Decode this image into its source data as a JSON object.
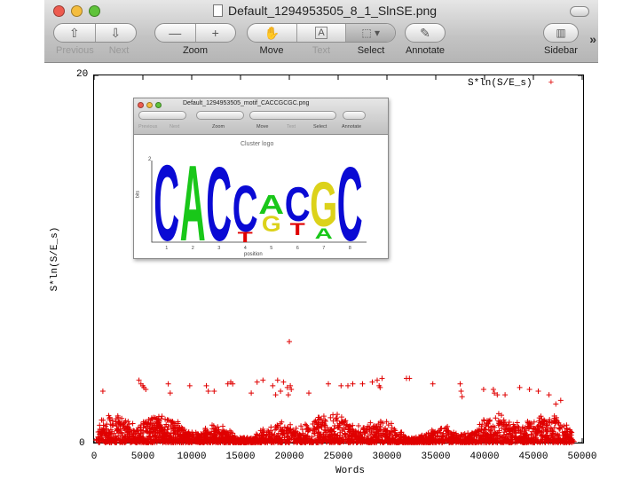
{
  "window": {
    "title": "Default_1294953505_8_1_SlnSE.png",
    "toolbar": {
      "nav": [
        "Previous",
        "Next"
      ],
      "zoom": "Zoom",
      "move": "Move",
      "text": "Text",
      "select": "Select",
      "annotate": "Annotate",
      "sidebar": "Sidebar"
    }
  },
  "inset_window": {
    "title": "Default_1294953505_motif_CACCGCGC.png",
    "toolbar": [
      "Previous",
      "Next",
      "Zoom",
      "Move",
      "Text",
      "Select",
      "Annotate"
    ],
    "logo_title": "Cluster logo",
    "logo_letters": [
      "C",
      "A",
      "C",
      "C",
      "A",
      "C",
      "G",
      "C"
    ],
    "logo_minor_letters": [
      "T",
      "G",
      "T",
      "A"
    ],
    "logo_ytick": "2",
    "logo_ylabel": "bits",
    "logo_positions": [
      "1",
      "2",
      "3",
      "4",
      "5",
      "6",
      "7",
      "8"
    ],
    "logo_xlabel": "position"
  },
  "chart_data": {
    "type": "scatter",
    "title": "",
    "xlabel": "Words",
    "ylabel": "S*ln(S/E_s)",
    "xlim": [
      0,
      50000
    ],
    "ylim": [
      0,
      20
    ],
    "xticks": [
      "0",
      "5000",
      "10000",
      "15000",
      "20000",
      "25000",
      "30000",
      "35000",
      "40000",
      "45000",
      "50000"
    ],
    "yticks": [
      "0",
      "20"
    ],
    "legend": {
      "label": "S*ln(S/E_s)",
      "position": "top-right",
      "marker": "+"
    },
    "series": [
      {
        "name": "S*ln(S/E_s)",
        "marker": "+",
        "color": "#e00000",
        "points": [
          [
            900,
            2.8
          ],
          [
            4600,
            3.4
          ],
          [
            4800,
            3.2
          ],
          [
            5100,
            3.0
          ],
          [
            5300,
            2.9
          ],
          [
            5000,
            3.1
          ],
          [
            7600,
            3.2
          ],
          [
            7800,
            2.7
          ],
          [
            9800,
            3.1
          ],
          [
            11500,
            3.1
          ],
          [
            11700,
            2.8
          ],
          [
            12300,
            2.8
          ],
          [
            13700,
            3.2
          ],
          [
            14000,
            3.3
          ],
          [
            14200,
            3.2
          ],
          [
            16100,
            2.7
          ],
          [
            16700,
            3.3
          ],
          [
            17300,
            3.4
          ],
          [
            18300,
            3.1
          ],
          [
            18600,
            2.6
          ],
          [
            18800,
            3.4
          ],
          [
            19100,
            2.8
          ],
          [
            19400,
            3.3
          ],
          [
            19800,
            3.0
          ],
          [
            20100,
            3.1
          ],
          [
            19900,
            2.6
          ],
          [
            20200,
            2.9
          ],
          [
            20000,
            5.5
          ],
          [
            22000,
            2.7
          ],
          [
            24000,
            3.2
          ],
          [
            25300,
            3.1
          ],
          [
            26000,
            3.1
          ],
          [
            26500,
            3.2
          ],
          [
            27500,
            3.2
          ],
          [
            28500,
            3.3
          ],
          [
            29000,
            3.4
          ],
          [
            29200,
            3.1
          ],
          [
            29500,
            3.5
          ],
          [
            29300,
            3.0
          ],
          [
            32000,
            3.5
          ],
          [
            32300,
            3.5
          ],
          [
            34700,
            3.2
          ],
          [
            37500,
            3.2
          ],
          [
            37600,
            2.8
          ],
          [
            37700,
            2.5
          ],
          [
            39900,
            2.9
          ],
          [
            40900,
            2.9
          ],
          [
            41000,
            2.7
          ],
          [
            41300,
            2.6
          ],
          [
            42100,
            2.6
          ],
          [
            43600,
            3.0
          ],
          [
            44600,
            2.9
          ],
          [
            45500,
            2.8
          ],
          [
            46600,
            2.6
          ],
          [
            47300,
            2.1
          ],
          [
            47800,
            2.3
          ]
        ]
      }
    ]
  },
  "colors": {
    "marker": "#e00000",
    "logo_C": "#0a0ad4",
    "logo_A": "#19c719",
    "logo_G": "#dcd21a",
    "logo_T": "#e00000",
    "light_close": "#ed5b4f",
    "light_min": "#f4bd3e",
    "light_max": "#5fc33a"
  }
}
